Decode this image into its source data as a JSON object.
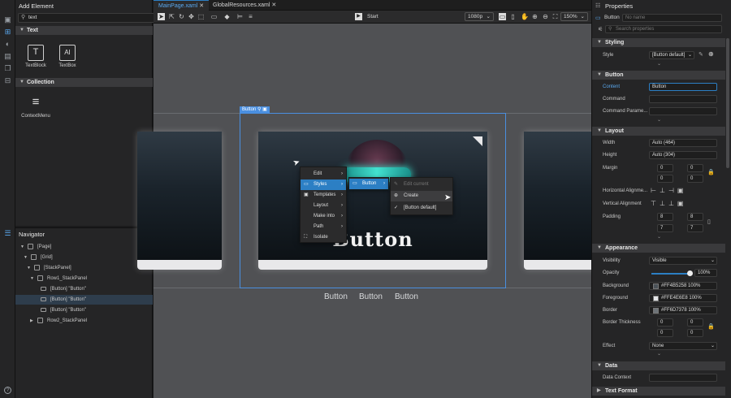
{
  "add_element": {
    "title": "Add Element",
    "search_value": "text",
    "sections": [
      {
        "label": "Text"
      },
      {
        "label": "Collection"
      }
    ],
    "tiles": [
      {
        "label": "TextBlock",
        "glyph": "T"
      },
      {
        "label": "TextBox",
        "glyph": "AI"
      },
      {
        "label": "ContextMenu",
        "glyph": "≡"
      }
    ]
  },
  "navigator": {
    "title": "Navigator",
    "items": [
      {
        "label": "[Page]"
      },
      {
        "label": "[Grid]"
      },
      {
        "label": "[StackPanel]"
      },
      {
        "label": "Row1_StackPanel"
      },
      {
        "label": "[Button] \"Button\""
      },
      {
        "label": "[Button] \"Button\""
      },
      {
        "label": "[Button] \"Button\""
      },
      {
        "label": "Row2_StackPanel"
      }
    ]
  },
  "tabs": [
    {
      "label": "MainPage.xaml"
    },
    {
      "label": "GlobalResources.xaml"
    }
  ],
  "toolbar": {
    "start": "Start",
    "resolution": "1080p",
    "zoom": "150%"
  },
  "canvas": {
    "selection_label": "Button",
    "card_text": "Button",
    "buttons": [
      "Button",
      "Button",
      "Button"
    ],
    "context_menu": [
      "Edit",
      "Styles",
      "Templates",
      "Layout",
      "Make into",
      "Path",
      "Isolate"
    ],
    "sub_menu": [
      "Button"
    ],
    "sub_sub_menu": [
      "Edit current",
      "Create",
      "[Button default]"
    ]
  },
  "properties": {
    "title": "Properties",
    "name": "Button",
    "name_placeholder": "No name",
    "search_placeholder": "Search properties",
    "sections": {
      "styling": "Styling",
      "button": "Button",
      "layout": "Layout",
      "appearance": "Appearance",
      "data": "Data",
      "text_format": "Text Format"
    },
    "style": {
      "label": "Style",
      "value": "[Button default]"
    },
    "content": {
      "label": "Content",
      "value": "Button"
    },
    "command": {
      "label": "Command"
    },
    "command_param": {
      "label": "Command Parame..."
    },
    "width": {
      "label": "Width",
      "value": "Auto (464)"
    },
    "height": {
      "label": "Height",
      "value": "Auto (304)"
    },
    "margin": {
      "label": "Margin",
      "values": [
        "0",
        "0",
        "0",
        "0"
      ]
    },
    "halign": {
      "label": "Horizontal Alignme..."
    },
    "valign": {
      "label": "Vertical Alignment"
    },
    "padding": {
      "label": "Padding",
      "values": [
        "8",
        "8",
        "7",
        "7"
      ]
    },
    "visibility": {
      "label": "Visibility",
      "value": "Visible"
    },
    "opacity": {
      "label": "Opacity",
      "value": "100%"
    },
    "background": {
      "label": "Background",
      "value": "#FF4B5258",
      "pct": "100%",
      "color": "#4b5258"
    },
    "foreground": {
      "label": "Foreground",
      "value": "#FFE4E6E8",
      "pct": "100%",
      "color": "#e4e6e8"
    },
    "border": {
      "label": "Border",
      "value": "#FF6D7378",
      "pct": "100%",
      "color": "#6d7378"
    },
    "border_thickness": {
      "label": "Border Thickness",
      "values": [
        "0",
        "0",
        "0",
        "0"
      ]
    },
    "effect": {
      "label": "Effect",
      "value": "None"
    },
    "data_context": {
      "label": "Data Context"
    }
  },
  "colors": {
    "accent": "#2c7fc4",
    "selection": "#4a8fe0"
  }
}
